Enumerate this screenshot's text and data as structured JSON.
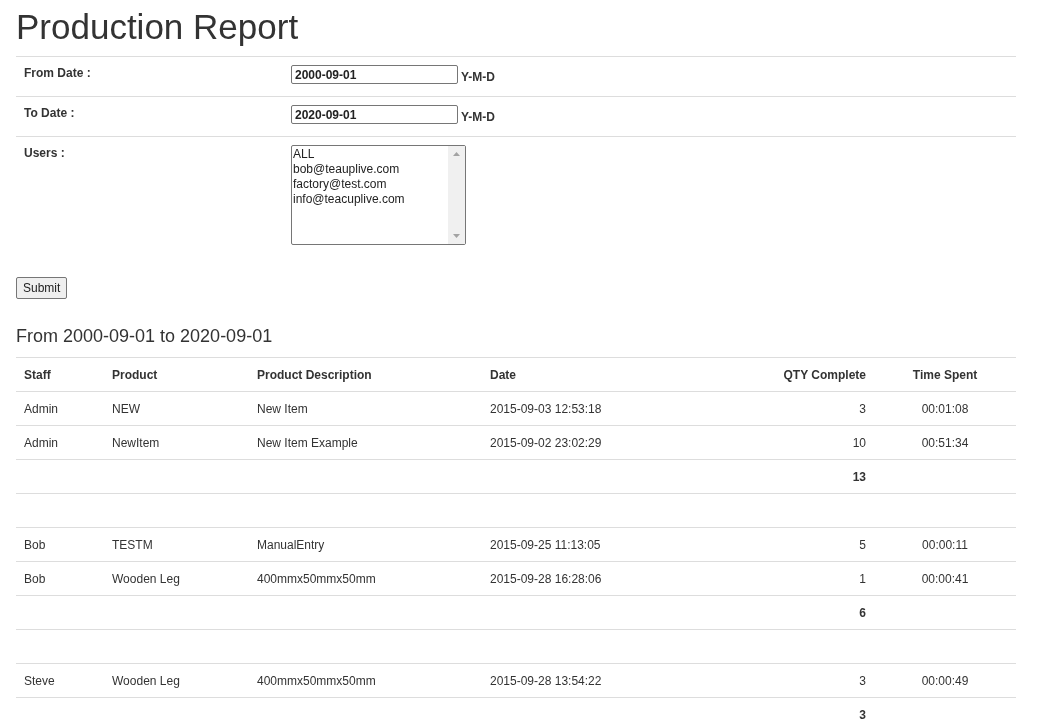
{
  "title": "Production Report",
  "form": {
    "fields": [
      {
        "label": "From Date :",
        "value": "2000-09-01",
        "hint": "Y-M-D"
      },
      {
        "label": "To Date :",
        "value": "2020-09-01",
        "hint": "Y-M-D"
      }
    ],
    "users": {
      "label": "Users :",
      "options": [
        "ALL",
        "bob@teauplive.com",
        "factory@test.com",
        "info@teacuplive.com"
      ]
    },
    "submit": "Submit"
  },
  "range_heading": "From 2000-09-01 to 2020-09-01",
  "table": {
    "columns": [
      "Staff",
      "Product",
      "Product Description",
      "Date",
      "QTY Complete",
      "Time Spent"
    ],
    "rows": [
      {
        "kind": "entry",
        "cells": [
          "Admin",
          "NEW",
          "New Item",
          "2015-09-03 12:53:18",
          "3",
          "00:01:08"
        ]
      },
      {
        "kind": "entry",
        "cells": [
          "Admin",
          "NewItem",
          "New Item Example",
          "2015-09-02 23:02:29",
          "10",
          "00:51:34"
        ]
      },
      {
        "kind": "total",
        "qty": "13"
      },
      {
        "kind": "spacer"
      },
      {
        "kind": "entry",
        "cells": [
          "Bob",
          "TESTM",
          "ManualEntry",
          "2015-09-25 11:13:05",
          "5",
          "00:00:11"
        ]
      },
      {
        "kind": "entry",
        "cells": [
          "Bob",
          "Wooden Leg",
          "400mmx50mmx50mm",
          "2015-09-28 16:28:06",
          "1",
          "00:00:41"
        ]
      },
      {
        "kind": "total",
        "qty": "6"
      },
      {
        "kind": "spacer"
      },
      {
        "kind": "entry",
        "cells": [
          "Steve",
          "Wooden Leg",
          "400mmx50mmx50mm",
          "2015-09-28 13:54:22",
          "3",
          "00:00:49"
        ]
      },
      {
        "kind": "total",
        "qty": "3"
      }
    ]
  }
}
